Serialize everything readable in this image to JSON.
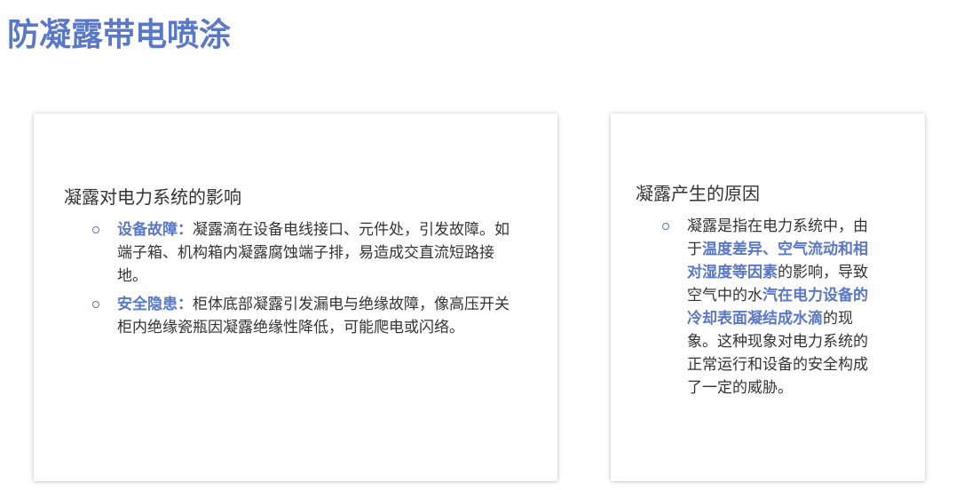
{
  "page": {
    "title": "防凝露带电喷涂"
  },
  "left_card": {
    "heading": "凝露对电力系统的影响",
    "items": [
      {
        "term": "设备故障：",
        "text": "凝露滴在设备电线接口、元件处，引发故障。如端子箱、机构箱内凝露腐蚀端子排，易造成交直流短路接地。"
      },
      {
        "term": "安全隐患：",
        "text": "柜体底部凝露引发漏电与绝缘故障，像高压开关柜内绝缘瓷瓶因凝露绝缘性降低，可能爬电或闪络。"
      }
    ]
  },
  "right_card": {
    "heading": "凝露产生的原因",
    "item": {
      "part1": "凝露是指在电力系统中，由于",
      "highlight1": "温度差异、空气流动和相对湿度等因素",
      "part2": "的影响，导致空气中的水",
      "highlight2": "汽在电力设备的冷却表面凝结成水滴",
      "part3": "的现象。这种现象对电力系统的正常运行和设备的安全构成了一定的威胁。"
    }
  },
  "colors": {
    "accent": "#5a78c8",
    "text": "#333333"
  }
}
